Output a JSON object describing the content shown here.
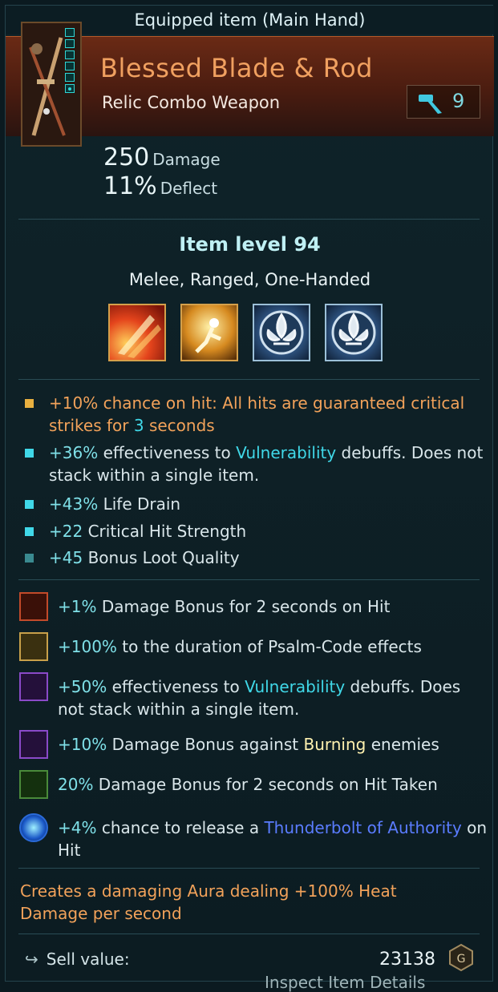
{
  "window": {
    "title": "Equipped item (Main Hand)"
  },
  "item": {
    "name": "Blessed Blade & Rod",
    "subtype": "Relic Combo Weapon",
    "rank": "9",
    "damage_value": "250",
    "damage_label": "Damage",
    "deflect_value": "11%",
    "deflect_label": "Deflect",
    "item_level": "Item level 94",
    "tags": "Melee, Ranged, One-Handed"
  },
  "abilities": [
    {
      "icon": "fire-slash-icon"
    },
    {
      "icon": "golden-strike-icon"
    },
    {
      "icon": "fleur-de-lis-icon"
    },
    {
      "icon": "fleur-de-lis-icon"
    }
  ],
  "affixes": [
    {
      "parts": [
        "+10% chance on hit: All hits are guaranteed critical strikes for ",
        "3",
        " seconds"
      ],
      "color": "#f2a25a",
      "bullet_color": "#e8b040"
    },
    {
      "parts": [
        "+36%",
        " effectiveness to ",
        "Vulnerability",
        " debuffs. Does not stack within a single item."
      ],
      "bullet_color": "#40d8e8"
    },
    {
      "parts": [
        "+43%",
        " Life Drain"
      ],
      "bullet_color": "#40d8e8"
    },
    {
      "parts": [
        "+22",
        " Critical Hit Strength"
      ],
      "bullet_color": "#40d8e8"
    },
    {
      "parts": [
        "+45",
        " Bonus Loot Quality"
      ],
      "bullet_color": "#3a8a90"
    }
  ],
  "mods": [
    {
      "parts": [
        "+1%",
        " Damage Bonus for 2 seconds on Hit"
      ],
      "badge_color": "#c24a2a"
    },
    {
      "parts": [
        "+100%",
        " to the duration of Psalm-Code effects"
      ],
      "badge_color": "#c8a04a"
    },
    {
      "parts": [
        "+50%",
        " effectiveness to ",
        "Vulnerability",
        " debuffs. Does not stack within a single item."
      ],
      "badge_color": "#8a4ac8"
    },
    {
      "parts": [
        "+10%",
        " Damage Bonus against ",
        "Burning",
        " enemies"
      ],
      "badge_color": "#8a4ac8"
    },
    {
      "parts": [
        "20%",
        " Damage Bonus for 2 seconds on Hit Taken"
      ],
      "badge_color": "#4a8a3a"
    },
    {
      "parts": [
        "+4%",
        " chance to release a ",
        "Thunderbolt of Authority",
        " on Hit"
      ],
      "badge_color": "#2a6ad8"
    }
  ],
  "aura_text": "Creates a damaging Aura dealing +100% Heat Damage per second",
  "sell": {
    "label": "Sell value:",
    "value": "23138"
  },
  "footer": {
    "partial_text": "Inspect Item Details"
  },
  "colors": {
    "accent_orange": "#f2a25a",
    "teal": "#40d8e8",
    "frame": "#0f2329"
  }
}
